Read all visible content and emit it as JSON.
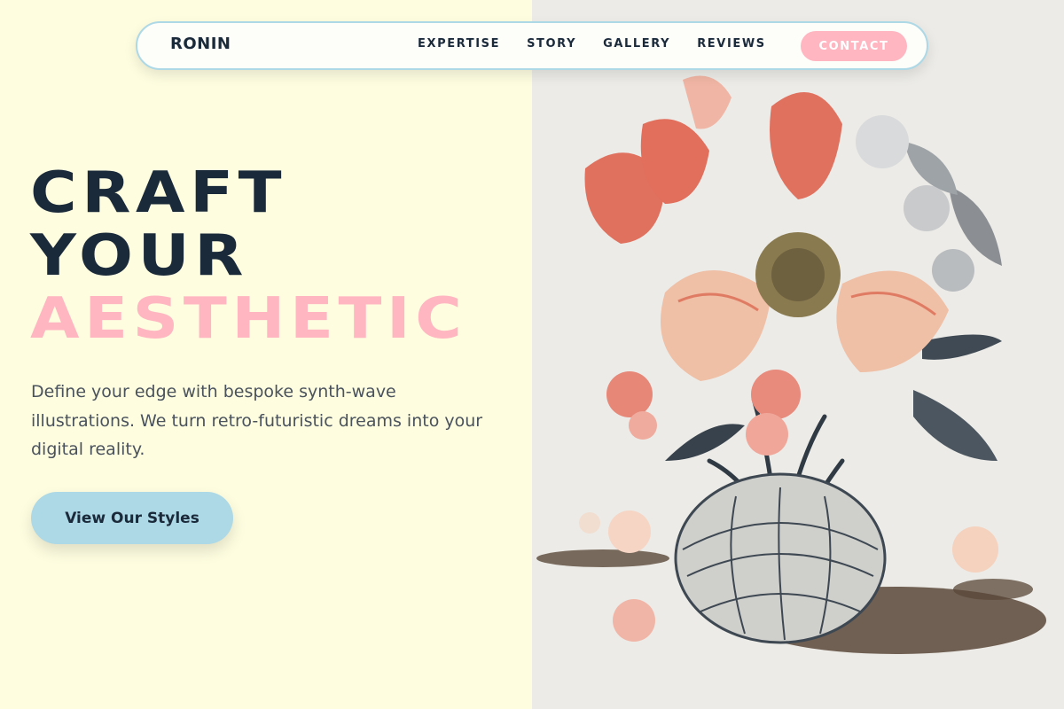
{
  "brand": "RONIN",
  "nav": {
    "links": [
      "EXPERTISE",
      "STORY",
      "GALLERY",
      "REVIEWS"
    ],
    "contact": "CONTACT"
  },
  "hero": {
    "line1": "CRAFT",
    "line2": "YOUR",
    "line3": "AESTHETIC",
    "description": "Define your edge with bespoke synth-wave illustrations. We turn retro-futuristic dreams into your digital reality.",
    "cta": "View Our Styles"
  },
  "colors": {
    "background": "#fefde0",
    "ink": "#1b2a3a",
    "accent_pink": "#ffb6c1",
    "accent_blue": "#add8e6",
    "image_background": "#ecebe7"
  },
  "image": {
    "subject": "botanical engraving of a flower bouquet in a glass vase"
  }
}
